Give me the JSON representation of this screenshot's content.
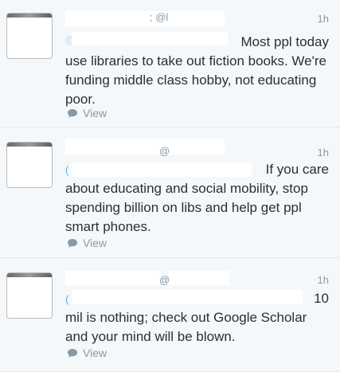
{
  "tweets": [
    {
      "handle_fragment": "; @l",
      "time": "1h",
      "mention_fragment": "@",
      "text_first": "Most ppl today",
      "text_rest": "use libraries to take out fiction books. We're funding middle class hobby, not educating poor.",
      "view_label": "View"
    },
    {
      "handle_fragment": "@",
      "time": "1h",
      "mention_fragment": "(",
      "text_first": "If you care",
      "text_rest": "about educating and social mobility, stop spending billion on libs and help get ppl smart phones.",
      "view_label": "View"
    },
    {
      "handle_fragment": "@l",
      "time": "1h",
      "mention_fragment": "(",
      "text_first": "10",
      "text_rest": "mil is nothing; check out Google Scholar and your mind will be blown.",
      "view_label": "View"
    }
  ],
  "colors": {
    "link": "#55acee",
    "muted": "#8899a6",
    "text": "#292f33",
    "row_bg": "#f5f8fa"
  }
}
